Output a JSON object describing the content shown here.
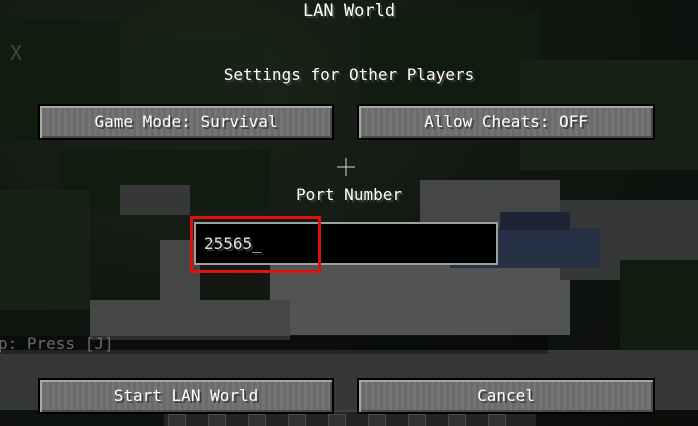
{
  "screen": {
    "title": "LAN World",
    "settings_label": "Settings for Other Players",
    "port_label": "Port Number"
  },
  "buttons": {
    "game_mode": "Game Mode: Survival",
    "allow_cheats": "Allow Cheats: OFF",
    "start_lan": "Start LAN World",
    "cancel": "Cancel"
  },
  "port_field": {
    "value": "25565",
    "caret": "_"
  },
  "chat": {
    "hint": "p: Press [J]"
  },
  "background": {
    "close_glyph": "X"
  },
  "colors": {
    "highlight": "#e01010",
    "button_face": "#6f6f6f",
    "text": "#ffffff"
  }
}
